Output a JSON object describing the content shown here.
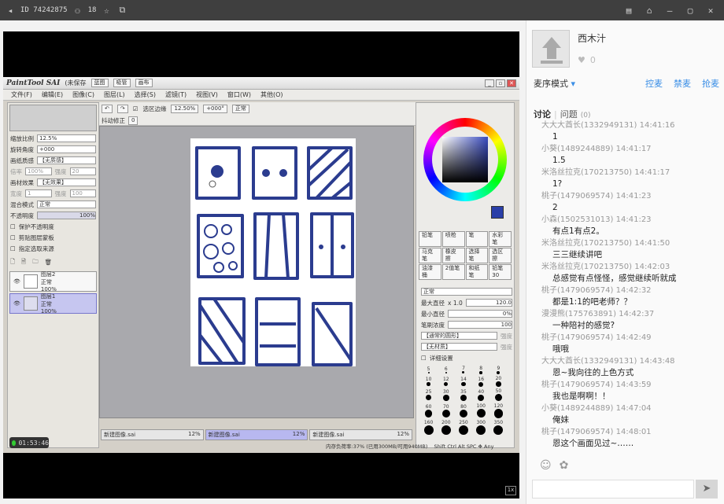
{
  "topbar": {
    "id_label": "ID 74242875",
    "viewers": "18"
  },
  "sai": {
    "app_title": "PaintTool SAI",
    "doc_state": "(未保存",
    "tool_tabs": [
      "蓝图",
      "吸管",
      "画布"
    ],
    "menu": [
      "文件(F)",
      "编辑(E)",
      "图像(C)",
      "图层(L)",
      "选择(S)",
      "滤镜(T)",
      "视图(V)",
      "窗口(W)",
      "其他(O)"
    ],
    "toolbar": {
      "select_border": "选区边缘",
      "zoom": "12.50%",
      "rotation": "+000°",
      "mode": "正常",
      "stabilizer_label": "抖动修正",
      "stabilizer_value": "0"
    },
    "left": {
      "zoom_label": "缩放比例",
      "zoom_value": "12.5%",
      "rotate_label": "旋转角度",
      "rotate_value": "+000",
      "paper_texture_label": "画纸质感",
      "paper_texture_value": "【无质感】",
      "paper_scale_label": "倍率",
      "paper_scale_value": "100%",
      "paper_strength_label": "强度",
      "paper_strength_value": "20",
      "paper_effect_label": "画材效果",
      "paper_effect_value": "【无效果】",
      "paper_width_label": "宽度",
      "paper_width_value": "1",
      "paper_effect_strength_label": "强度",
      "paper_effect_strength_value": "100",
      "blend_label": "混合模式",
      "blend_value": "正常",
      "opacity_label": "不透明度",
      "opacity_value": "100%",
      "opt1": "保护不透明度",
      "opt2": "剪贴图层蒙板",
      "opt3": "指定选取来源",
      "layers": [
        {
          "name": "图层2",
          "mode": "正常",
          "opacity": "100%"
        },
        {
          "name": "图层1",
          "mode": "正常",
          "opacity": "100%"
        }
      ]
    },
    "right": {
      "brushes": [
        "铅笔",
        "喷枪",
        "笔",
        "水彩笔",
        "马克笔",
        "橡皮擦",
        "选择笔",
        "选区擦",
        "油漆桶",
        "2值笔",
        "和纸笔",
        "铅笔30"
      ],
      "blend_mode": "正常",
      "max_size_label": "最大直径",
      "max_size_mult": "x 1.0",
      "max_size_value": "120.0",
      "min_size_label": "最小直径",
      "min_size_value": "0%",
      "density_label": "笔刷浓度",
      "density_value": "100",
      "shape1": "【通常的圆形】",
      "shape1_strength": "强度",
      "shape2": "【无材质】",
      "shape2_strength": "强度",
      "detail_label": "详细设置",
      "sizes": [
        "5",
        "6",
        "7",
        "8",
        "9",
        "10",
        "12",
        "14",
        "16",
        "20",
        "25",
        "30",
        "35",
        "40",
        "50",
        "60",
        "70",
        "80",
        "100",
        "120",
        "160",
        "200",
        "250",
        "300",
        "350"
      ]
    },
    "tabs": [
      {
        "name": "新建图像.sai",
        "zoom": "12%"
      },
      {
        "name": "新建图像.sai",
        "zoom": "12%"
      },
      {
        "name": "新建图像.sai",
        "zoom": "12%"
      }
    ],
    "status": "内存负荷率:37% (已用300MB/可用940MB)",
    "keys": "Shift Ctrl Alt SPC ✥ Any"
  },
  "timer": "01:53:46",
  "fullscreen_label": "1x",
  "side": {
    "username": "西木汁",
    "likes": "0",
    "sort_label": "麦序模式",
    "sort_links": [
      "控麦",
      "禁麦",
      "抢麦"
    ],
    "tab_discuss": "讨论",
    "tab_question": "问题",
    "question_count": "(0)",
    "messages": [
      {
        "user": "大大大酋长(1332949131)",
        "time": "14:41:16",
        "text": "1"
      },
      {
        "user": "小葵(1489244889)",
        "time": "14:41:17",
        "text": "1.5"
      },
      {
        "user": "米洛丝拉克(170213750)",
        "time": "14:41:17",
        "text": "1?"
      },
      {
        "user": "桃子(1479069574)",
        "time": "14:41:23",
        "text": "2"
      },
      {
        "user": "小森(1502531013)",
        "time": "14:41:23",
        "text": "有点1有点2。"
      },
      {
        "user": "米洛丝拉克(170213750)",
        "time": "14:41:50",
        "text": "三三继续讲吧"
      },
      {
        "user": "米洛丝拉克(170213750)",
        "time": "14:42:03",
        "text": "总感觉有点怪怪，感觉继续听就成"
      },
      {
        "user": "桃子(1479069574)",
        "time": "14:42:32",
        "text": "都是1:1的吧老师？？"
      },
      {
        "user": "漫漫熊(175763891)",
        "time": "14:42:37",
        "text": "一种陪衬的感觉?"
      },
      {
        "user": "桃子(1479069574)",
        "time": "14:42:49",
        "text": "哦哦"
      },
      {
        "user": "大大大酋长(1332949131)",
        "time": "14:43:48",
        "text": "恩~我向往的上色方式"
      },
      {
        "user": "桃子(1479069574)",
        "time": "14:43:59",
        "text": "我也是啊啊！！"
      },
      {
        "user": "小葵(1489244889)",
        "time": "14:47:04",
        "text": "俺妹"
      },
      {
        "user": "桃子(1479069574)",
        "time": "14:48:01",
        "text": "恩这个画面见过~……"
      }
    ]
  }
}
